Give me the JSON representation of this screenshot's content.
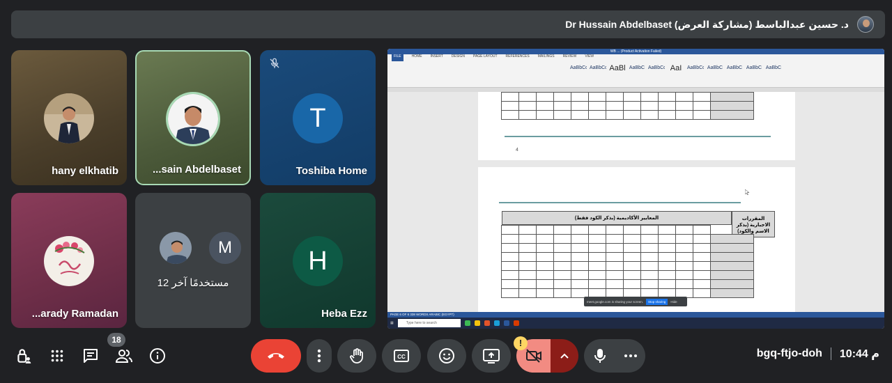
{
  "presenter": {
    "label": "Dr Hussain Abdelbaset د. حسين عبدالباسط (مشاركة العرض)"
  },
  "tiles": [
    {
      "name": "hany elkhatib"
    },
    {
      "name": "...sain Abdelbaset"
    },
    {
      "name": "Toshiba Home",
      "initial": "T",
      "avatar_color": "#1967a8"
    },
    {
      "name": "...arady Ramadan"
    },
    {
      "name": "12 مستخدمًا آخر",
      "initial": "M",
      "avatar_color": "#4a5360"
    },
    {
      "name": "Heba Ezz",
      "initial": "H",
      "avatar_color": "#0d5a45"
    }
  ],
  "shared_screen": {
    "window_title": "WB ... (Product Activation Failed)",
    "tabs": [
      "FILE",
      "HOME",
      "INSERT",
      "DESIGN",
      "PAGE LAYOUT",
      "REFERENCES",
      "MAILINGS",
      "REVIEW",
      "VIEW"
    ],
    "styles": [
      "AaBbCcDc",
      "AaBbCcDc",
      "AaBl",
      "AaBbC",
      "AaBbCcI",
      "AaI",
      "AaBbCcC",
      "AaBbC",
      "AaBbC",
      "AaBbC",
      "AaBbC"
    ],
    "page_number": "4",
    "table_header": "المعايير الأكاديمية (بذكر الكود فقط)",
    "table_right_header": "المقررات الاجبارية (بذكر الاسم والكود)",
    "share_notice": "meet.google.com is sharing your screen.",
    "stop_sharing": "Stop sharing",
    "hide": "Hide",
    "status": "PAGE 6 OF 6    338 WORDS    ARABIC (EGYPT)",
    "taskbar_search": "Type here to search"
  },
  "controls": {
    "participants_count": "18",
    "warning": "!",
    "meeting_code": "bgq-ftjo-doh",
    "time": "10:44 م"
  },
  "colors": {
    "background": "#202124",
    "end_call": "#ea4335",
    "camera_off": "#f28b82",
    "active_speaker": "#a8dab5"
  }
}
